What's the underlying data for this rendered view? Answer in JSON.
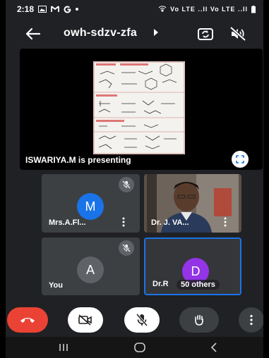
{
  "status_bar": {
    "time": "2:18",
    "left_icons": [
      "image-icon",
      "gmail-icon",
      "google-icon",
      "dot-icon"
    ],
    "right_text": "Vo LTE ..Il Vo LTE ..Il"
  },
  "top_bar": {
    "meeting_code": "owh-sdzv-zfa"
  },
  "presentation": {
    "presenter_label": "ISWARIYA.M is presenting"
  },
  "participants": [
    {
      "name": "Mrs.A.Fl...",
      "initial": "M",
      "avatar_color": "#1a73e8",
      "muted": true
    },
    {
      "name": "Dr. J. VA...",
      "has_video": true
    },
    {
      "name": "You",
      "initial": "A",
      "avatar_color": "#5f6368",
      "muted": true
    },
    {
      "name": "Dr.R",
      "initial": "D",
      "avatar_color": "#9334e6",
      "others": "50 others",
      "active": true
    }
  ],
  "controls": {
    "end_call_color": "#ea4335"
  },
  "colors": {
    "background": "#202124",
    "tile": "#3c4043",
    "accent": "#1a73e8"
  }
}
